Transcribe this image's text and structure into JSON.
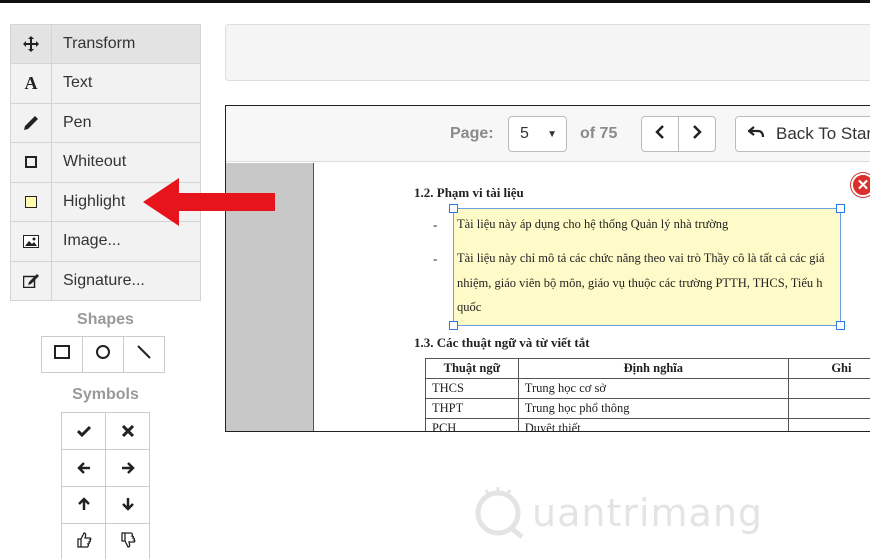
{
  "tools": [
    {
      "id": "transform",
      "label": "Transform",
      "icon": "move-icon"
    },
    {
      "id": "text",
      "label": "Text",
      "icon": "text-icon"
    },
    {
      "id": "pen",
      "label": "Pen",
      "icon": "pen-icon"
    },
    {
      "id": "whiteout",
      "label": "Whiteout",
      "icon": "whiteout-square-icon"
    },
    {
      "id": "highlight",
      "label": "Highlight",
      "icon": "highlight-square-icon"
    },
    {
      "id": "image",
      "label": "Image...",
      "icon": "image-icon"
    },
    {
      "id": "signature",
      "label": "Signature...",
      "icon": "signature-icon"
    }
  ],
  "shapes_title": "Shapes",
  "shapes": [
    "rectangle-icon",
    "circle-icon",
    "line-icon"
  ],
  "symbols_title": "Symbols",
  "symbols": [
    "check-icon",
    "x-icon",
    "arrow-left-icon",
    "arrow-right-icon",
    "arrow-up-icon",
    "arrow-down-icon",
    "thumbs-up-icon",
    "thumbs-down-icon"
  ],
  "viewer": {
    "page_label": "Page:",
    "page_value": "5",
    "of_label": "of 75",
    "back_label": "Back To Star"
  },
  "document": {
    "h12": "1.2.   Phạm vi tài liệu",
    "bullet1": "Tài liệu này áp dụng cho hệ thống Quản lý nhà trường",
    "bullet2_line1": "Tài liệu này chỉ mô tả các chức năng theo vai trò Thầy cô là tất cả các giá",
    "bullet2_line2": "nhiệm, giáo viên bộ môn, giáo vụ thuộc các trường PTTH, THCS, Tiểu h",
    "bullet2_line3": "quốc",
    "h13": "1.3.   Các thuật ngữ và từ viết tắt",
    "table_headers": [
      "Thuật ngữ",
      "Định nghĩa",
      "Ghi"
    ],
    "table_rows": [
      [
        "THCS",
        "Trung học cơ sở",
        ""
      ],
      [
        "THPT",
        "Trung học phổ thông",
        ""
      ],
      [
        "PCH",
        "Duyệt thiết",
        ""
      ]
    ]
  },
  "watermark": "uantrimang",
  "colors": {
    "arrow": "#e8141b",
    "highlight": "#fffbc8",
    "close": "#d9302c"
  }
}
